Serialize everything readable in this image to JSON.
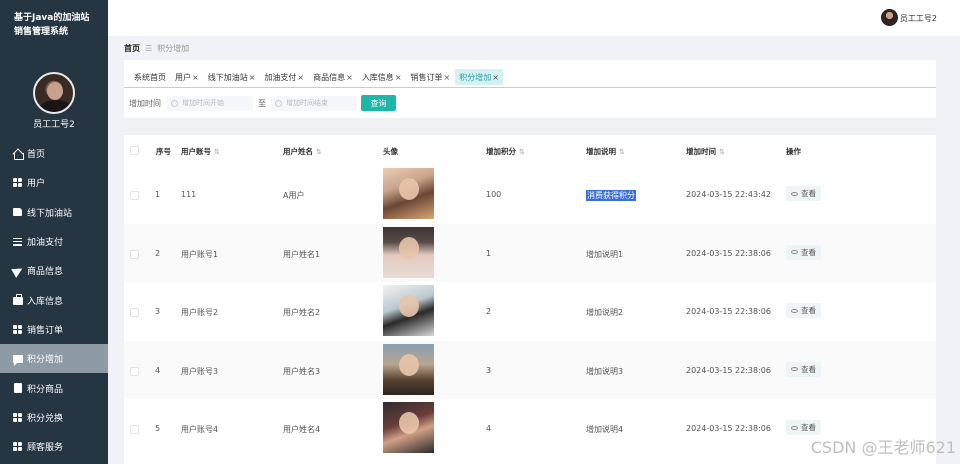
{
  "brand": {
    "title": "基于Java的加油站销售管理系统"
  },
  "sidebar": {
    "user": "员工工号2",
    "items": [
      {
        "label": "首页",
        "icon": "home-icon"
      },
      {
        "label": "用户",
        "icon": "grid-icon"
      },
      {
        "label": "线下加油站",
        "icon": "thumb-icon"
      },
      {
        "label": "加油支付",
        "icon": "list-icon"
      },
      {
        "label": "商品信息",
        "icon": "send-icon"
      },
      {
        "label": "入库信息",
        "icon": "briefcase-icon"
      },
      {
        "label": "销售订单",
        "icon": "grid-icon"
      },
      {
        "label": "积分增加",
        "icon": "chat-icon",
        "active": true
      },
      {
        "label": "积分商品",
        "icon": "clipboard-icon"
      },
      {
        "label": "积分兑换",
        "icon": "grid-icon"
      },
      {
        "label": "顾客服务",
        "icon": "grid-icon"
      }
    ]
  },
  "topbar": {
    "user": "员工工号2"
  },
  "breadcrumb": {
    "home": "首页",
    "sep": "☰",
    "current": "积分增加"
  },
  "tabs": [
    {
      "label": "系统首页",
      "closable": false
    },
    {
      "label": "用户",
      "closable": true
    },
    {
      "label": "线下加油站",
      "closable": true
    },
    {
      "label": "加油支付",
      "closable": true
    },
    {
      "label": "商品信息",
      "closable": true
    },
    {
      "label": "入库信息",
      "closable": true
    },
    {
      "label": "销售订单",
      "closable": true
    },
    {
      "label": "积分增加",
      "closable": true,
      "active": true
    }
  ],
  "search": {
    "label": "增加时间",
    "start_placeholder": "增加时间开始",
    "to": "至",
    "end_placeholder": "增加时间结束",
    "query": "查询"
  },
  "table": {
    "headers": {
      "index": "序号",
      "account": "用户账号",
      "name": "用户姓名",
      "avatar": "头像",
      "points": "增加积分",
      "desc": "增加说明",
      "time": "增加时间",
      "ops": "操作"
    },
    "view_label": "查看",
    "rows": [
      {
        "index": "1",
        "account": "111",
        "name": "A用户",
        "points": "100",
        "desc": "消费获得积分",
        "time": "2024-03-15 22:43:42",
        "highlight": true
      },
      {
        "index": "2",
        "account": "用户账号1",
        "name": "用户姓名1",
        "points": "1",
        "desc": "增加说明1",
        "time": "2024-03-15 22:38:06"
      },
      {
        "index": "3",
        "account": "用户账号2",
        "name": "用户姓名2",
        "points": "2",
        "desc": "增加说明2",
        "time": "2024-03-15 22:38:06"
      },
      {
        "index": "4",
        "account": "用户账号3",
        "name": "用户姓名3",
        "points": "3",
        "desc": "增加说明3",
        "time": "2024-03-15 22:38:06"
      },
      {
        "index": "5",
        "account": "用户账号4",
        "name": "用户姓名4",
        "points": "4",
        "desc": "增加说明4",
        "time": "2024-03-15 22:38:06"
      }
    ]
  },
  "watermark": "CSDN @王老师621"
}
